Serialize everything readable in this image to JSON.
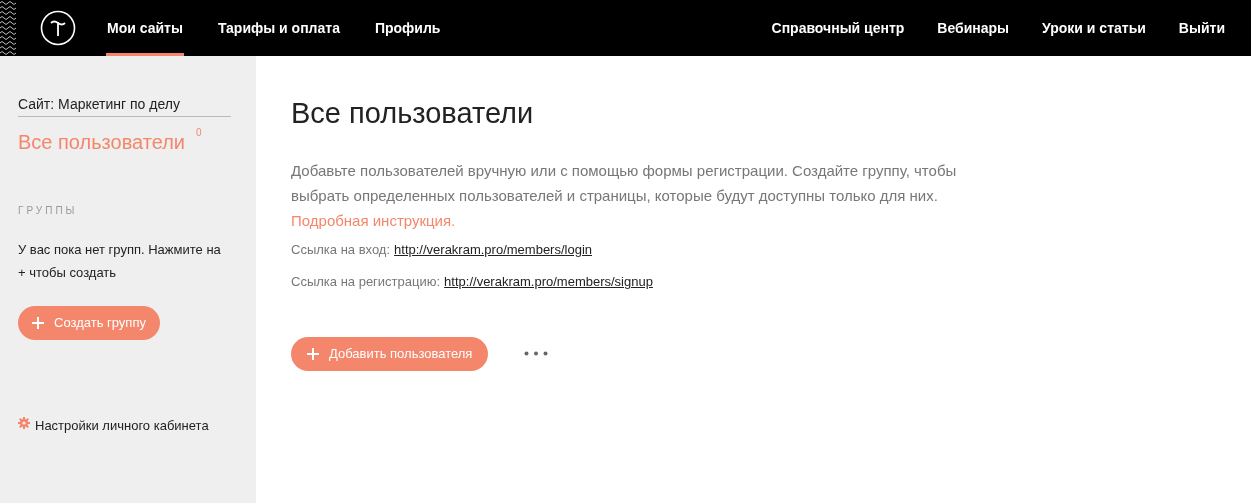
{
  "header": {
    "nav": [
      {
        "label": "Мои сайты",
        "selected": true
      },
      {
        "label": "Тарифы и оплата",
        "selected": false
      },
      {
        "label": "Профиль",
        "selected": false
      }
    ],
    "right_nav": [
      "Справочный центр",
      "Вебинары",
      "Уроки и статьи",
      "Выйти"
    ]
  },
  "sidebar": {
    "site": "Сайт: Маркетинг по делу",
    "title": "Все пользователи",
    "count": "0",
    "groups_heading": "ГРУППЫ",
    "groups_empty": "У вас пока нет групп. Нажмите на + чтобы создать",
    "create_button": "Создать группу",
    "settings": "Настройки личного кабинета"
  },
  "main": {
    "title": "Все пользователи",
    "description": "Добавьте пользователей вручную или с помощью формы регистрации. Создайте группу, чтобы выбрать определенных пользователей и страницы, которые будут доступны только для них.",
    "instruction_link": "Подробная инструкция.",
    "links": [
      {
        "label": "Ссылка на вход:",
        "url": "http://verakram.pro/members/login"
      },
      {
        "label": "Ссылка на регистрацию:",
        "url": "http://verakram.pro/members/signup"
      }
    ],
    "add_button": "Добавить пользователя"
  }
}
